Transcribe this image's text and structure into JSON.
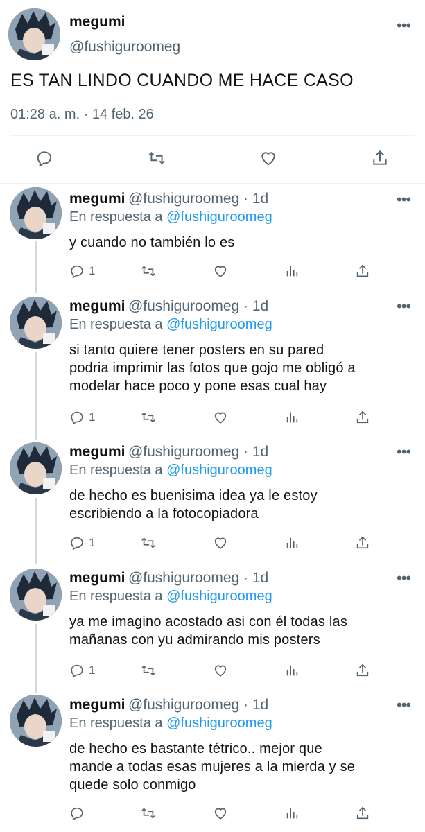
{
  "main_tweet": {
    "name": "megumi",
    "handle": "@fushiguroomeg",
    "text": "ES TAN LINDO CUANDO ME HACE CASO",
    "timestamp": "01:28 a. m. · 14 feb. 26",
    "more_icon": "more-icon",
    "actions": [
      "reply-icon",
      "retweet-icon",
      "like-icon",
      "share-icon"
    ]
  },
  "replies": [
    {
      "name": "megumi",
      "handle": "@fushiguroomeg · 1d",
      "reply_prefix": "En respuesta a ",
      "reply_to": "@fushiguroomeg",
      "lines": [
        "y cuando no también lo es"
      ],
      "reply_count": "1"
    },
    {
      "name": "megumi",
      "handle": "@fushiguroomeg · 1d",
      "reply_prefix": "En respuesta a ",
      "reply_to": "@fushiguroomeg",
      "lines": [
        "si tanto quiere tener posters en su pared",
        "podria imprimir las fotos que gojo me obligó a",
        "modelar hace poco y pone esas cual hay"
      ],
      "reply_count": "1"
    },
    {
      "name": "megumi",
      "handle": "@fushiguroomeg · 1d",
      "reply_prefix": "En respuesta a ",
      "reply_to": "@fushiguroomeg",
      "lines": [
        "de hecho es buenisima idea ya le estoy",
        "escribiendo a la fotocopiadora"
      ],
      "reply_count": "1"
    },
    {
      "name": "megumi",
      "handle": "@fushiguroomeg · 1d",
      "reply_prefix": "En respuesta a ",
      "reply_to": "@fushiguroomeg",
      "lines": [
        "ya me imagino acostado asi con él todas las",
        "mañanas con yu admirando mis posters"
      ],
      "reply_count": "1"
    },
    {
      "name": "megumi",
      "handle": "@fushiguroomeg · 1d",
      "reply_prefix": "En respuesta a ",
      "reply_to": "@fushiguroomeg",
      "lines": [
        "de hecho es bastante tétrico.. mejor que",
        "mande a todas esas mujeres a la mierda y se",
        "quede solo conmigo"
      ],
      "reply_count": ""
    }
  ],
  "colors": {
    "link": "#1d9bf0",
    "secondary": "#536471",
    "thread_line": "#cfd9de"
  }
}
